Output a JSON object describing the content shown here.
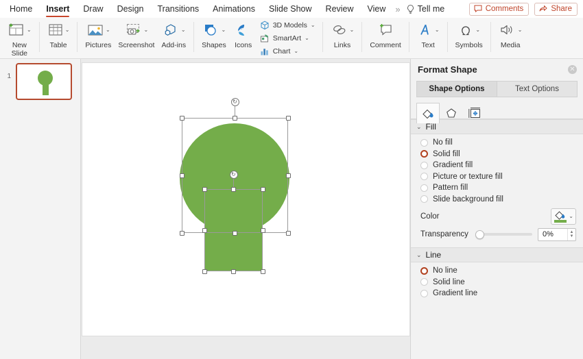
{
  "ribbon_tabs": [
    {
      "label": "Home",
      "active": false
    },
    {
      "label": "Insert",
      "active": true
    },
    {
      "label": "Draw",
      "active": false
    },
    {
      "label": "Design",
      "active": false
    },
    {
      "label": "Transitions",
      "active": false
    },
    {
      "label": "Animations",
      "active": false
    },
    {
      "label": "Slide Show",
      "active": false
    },
    {
      "label": "Review",
      "active": false
    },
    {
      "label": "View",
      "active": false
    }
  ],
  "overflow_chevron": "»",
  "tell_me": {
    "label": "Tell me",
    "icon": "lightbulb-icon"
  },
  "top_right": {
    "comments": {
      "label": "Comments",
      "icon": "comment-icon"
    },
    "share": {
      "label": "Share",
      "icon": "share-icon"
    },
    "accent_color": "#c0452b"
  },
  "ribbon_groups": {
    "new_slide": {
      "label": "New\nSlide",
      "icon": "new-slide-icon",
      "caret": "⌄"
    },
    "table": {
      "label": "Table",
      "icon": "table-icon",
      "caret": "⌄"
    },
    "pictures": {
      "label": "Pictures",
      "icon": "pictures-icon",
      "caret": "⌄"
    },
    "screenshot": {
      "label": "Screenshot",
      "icon": "screenshot-icon",
      "caret": "⌄"
    },
    "add_ins": {
      "label": "Add-ins",
      "icon": "addins-icon",
      "caret": "⌄"
    },
    "shapes": {
      "label": "Shapes",
      "icon": "shapes-icon",
      "caret": "⌄"
    },
    "icons": {
      "label": "Icons",
      "icon": "icons-icon"
    },
    "illustrations_stack": [
      {
        "label": "3D Models",
        "icon": "3d-models-icon",
        "caret": "⌄"
      },
      {
        "label": "SmartArt",
        "icon": "smartart-icon",
        "caret": "⌄"
      },
      {
        "label": "Chart",
        "icon": "chart-icon",
        "caret": "⌄"
      }
    ],
    "links": {
      "label": "Links",
      "icon": "links-icon",
      "caret": "⌄"
    },
    "comment": {
      "label": "Comment",
      "icon": "comment-new-icon"
    },
    "text": {
      "label": "Text",
      "icon": "text-icon",
      "caret": "⌄"
    },
    "symbols": {
      "label": "Symbols",
      "icon": "symbols-icon",
      "caret": "⌄"
    },
    "media": {
      "label": "Media",
      "icon": "media-icon",
      "caret": "⌄"
    }
  },
  "thumbnails": [
    {
      "number": "1",
      "selected": true,
      "selection_color": "#b54a2e"
    }
  ],
  "slide": {
    "background": "#ffffff",
    "shape_fill": "#74ad4a",
    "shapes": [
      {
        "name": "circle",
        "type": "oval",
        "selected": true
      },
      {
        "name": "rectangle",
        "type": "rect",
        "selected": true
      }
    ]
  },
  "panel": {
    "title": "Format Shape",
    "close_icon": "close-icon",
    "tabs": [
      {
        "label": "Shape Options",
        "active": true
      },
      {
        "label": "Text Options",
        "active": false
      }
    ],
    "icon_tabs": [
      {
        "name": "fill-and-line-icon",
        "active": true
      },
      {
        "name": "effects-pentagon-icon",
        "active": false
      },
      {
        "name": "size-properties-icon",
        "active": false
      }
    ],
    "fill_section": {
      "title": "Fill",
      "collapse_icon": "⌄",
      "options": [
        {
          "label": "No fill",
          "selected": false
        },
        {
          "label": "Solid fill",
          "selected": true
        },
        {
          "label": "Gradient fill",
          "selected": false
        },
        {
          "label": "Picture or texture fill",
          "selected": false
        },
        {
          "label": "Pattern fill",
          "selected": false
        },
        {
          "label": "Slide background fill",
          "selected": false
        }
      ],
      "color": {
        "label": "Color",
        "icon": "fill-bucket-icon",
        "swatch": "#74ad4a",
        "caret": "⌄"
      },
      "transparency": {
        "label": "Transparency",
        "value": "0%",
        "percent": 0
      }
    },
    "line_section": {
      "title": "Line",
      "collapse_icon": "⌄",
      "options": [
        {
          "label": "No line",
          "selected": true
        },
        {
          "label": "Solid line",
          "selected": false
        },
        {
          "label": "Gradient line",
          "selected": false
        }
      ]
    },
    "selected_radio_color": "#b1411f"
  }
}
